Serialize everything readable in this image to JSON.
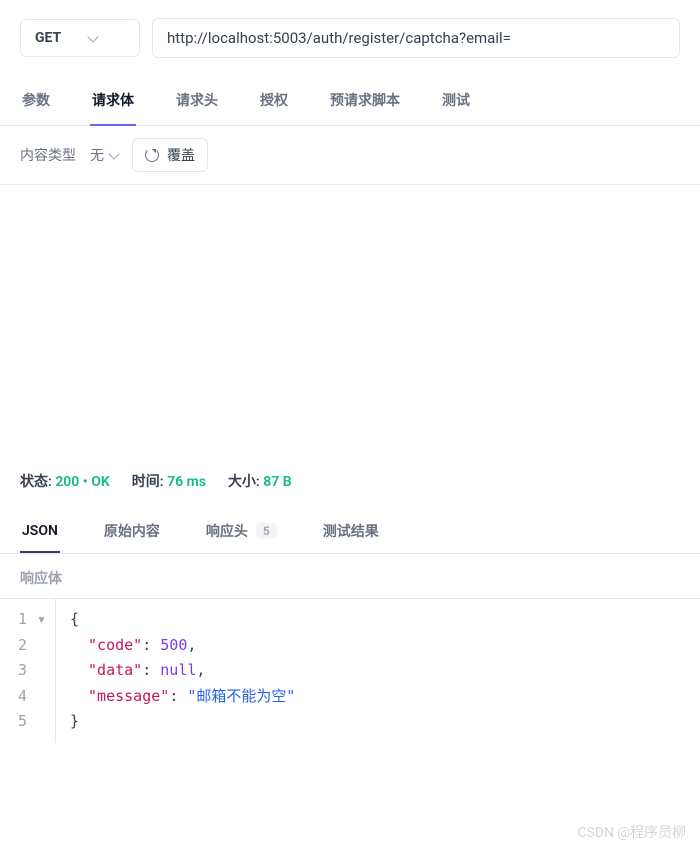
{
  "request": {
    "method": "GET",
    "url": "http://localhost:5003/auth/register/captcha?email="
  },
  "tabs": {
    "items": [
      "参数",
      "请求体",
      "请求头",
      "授权",
      "预请求脚本",
      "测试"
    ],
    "active_index": 1
  },
  "body_toolbar": {
    "content_type_label": "内容类型",
    "type_value": "无",
    "override_label": "覆盖"
  },
  "response": {
    "status_label": "状态:",
    "status_code": "200",
    "status_text": "OK",
    "time_label": "时间:",
    "time_value": "76 ms",
    "size_label": "大小:",
    "size_value": "87 B",
    "tabs": {
      "json": "JSON",
      "raw": "原始内容",
      "headers": "响应头",
      "headers_count": "5",
      "tests": "测试结果"
    },
    "body_section_label": "响应体",
    "json_body": {
      "code": 500,
      "data": null,
      "message": "邮箱不能为空"
    },
    "code_lines": {
      "l1": "{",
      "l2_key": "\"code\"",
      "l2_val": "500",
      "l3_key": "\"data\"",
      "l3_val": "null",
      "l4_key": "\"message\"",
      "l4_val": "\"邮箱不能为空\"",
      "l5": "}"
    },
    "line_numbers": [
      "1",
      "2",
      "3",
      "4",
      "5"
    ]
  },
  "watermark": "CSDN @程序员柳"
}
